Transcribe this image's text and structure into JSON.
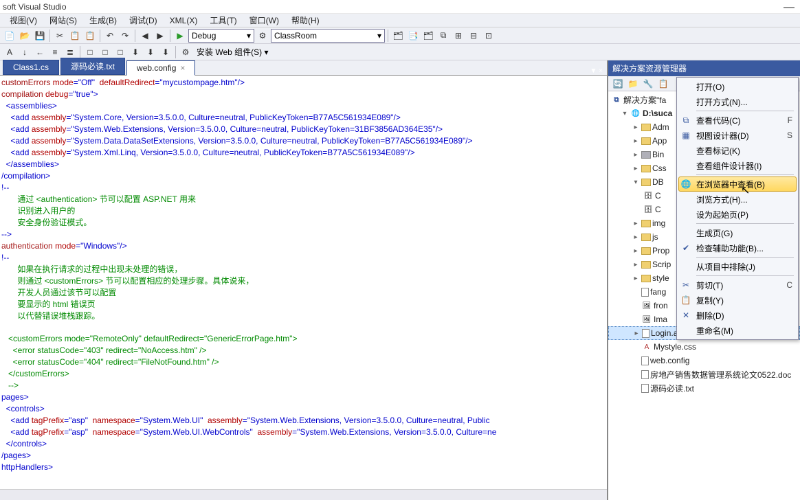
{
  "title": "soft Visual Studio",
  "menu": {
    "view": "视图(V)",
    "website": "网站(S)",
    "build": "生成(B)",
    "debug": "调试(D)",
    "xml": "XML(X)",
    "tools": "工具(T)",
    "window": "窗口(W)",
    "help": "帮助(H)"
  },
  "toolbar": {
    "config": "Debug",
    "project": "ClassRoom",
    "install": "安装 Web 组件(S)"
  },
  "tabs": {
    "class": "Class1.cs",
    "readme": "源码必读.txt",
    "webconfig": "web.config"
  },
  "sidepanel": {
    "title": "解决方案资源管理器"
  },
  "solution": {
    "label": "解决方案\"fa"
  },
  "project": {
    "label": "D:\\suca"
  },
  "tree": {
    "adm": "Adm",
    "app": "App",
    "bin": "Bin",
    "css": "Css",
    "db": "DB",
    "dbc1": "C",
    "dbc2": "C",
    "img": "img",
    "js": "js",
    "prop": "Prop",
    "scrip": "Scrip",
    "style": "style",
    "fang": "fang",
    "fron": "fron",
    "ima": "Ima",
    "login": "Login.aspx",
    "mystyle": "Mystyle.css",
    "webconfig": "web.config",
    "doc": "房地产销售数据管理系统论文0522.doc",
    "readme": "源码必读.txt"
  },
  "cm": {
    "open": "打开(O)",
    "openwith": "打开方式(N)...",
    "viewcode": "查看代码(C)",
    "viewdesigner": "视图设计器(D)",
    "viewmarkup": "查看标记(K)",
    "viewcomponent": "查看组件设计器(I)",
    "browse": "在浏览器中查看(B)",
    "browsewith": "浏览方式(H)...",
    "setstart": "设为起始页(P)",
    "build": "生成页(G)",
    "check": "检查辅助功能(B)...",
    "exclude": "从项目中排除(J)",
    "cut": "剪切(T)",
    "copy": "复制(Y)",
    "delete": "删除(D)",
    "rename": "重命名(M)",
    "sc_f": "F",
    "sc_s": "S",
    "sc_c": "C"
  },
  "code": {
    "l1a": "customErrors",
    "l1b": " mode",
    "l1c": "=\"Off\"",
    "l1d": "  defaultRedirect",
    "l1e": "=\"mycustompage.htm\"/>",
    "l2a": "compilation",
    "l2b": " debug",
    "l2c": "=\"true\">",
    "l3": "  <assemblies>",
    "add": "    <add",
    "asm": " assembly",
    "l4v": "=\"System.Core, Version=3.5.0.0, Culture=neutral, PublicKeyToken=B77A5C561934E089\"/>",
    "l5v": "=\"System.Web.Extensions, Version=3.5.0.0, Culture=neutral, PublicKeyToken=31BF3856AD364E35\"/>",
    "l6v": "=\"System.Data.DataSetExtensions, Version=3.5.0.0, Culture=neutral, PublicKeyToken=B77A5C561934E089\"/>",
    "l7v": "=\"System.Xml.Linq, Version=3.5.0.0, Culture=neutral, PublicKeyToken=B77A5C561934E089\"/>",
    "l8": "  </assemblies>",
    "l9": "/compilation>",
    "l10": "!--",
    "c1": "       通过 <authentication> 节可以配置 ASP.NET 用来 ",
    "c2": "       识别进入用户的",
    "c3": "       安全身份验证模式。 ",
    "l14": "-->",
    "l15a": "authentication",
    "l15b": " mode",
    "l15c": "=\"Windows\"/>",
    "l16": "!--",
    "c4": "       如果在执行请求的过程中出现未处理的错误，",
    "c5": "       则通过 <customErrors> 节可以配置相应的处理步骤。具体说来，",
    "c6": "       开发人员通过该节可以配置",
    "c7": "       要显示的 html 错误页",
    "c8": "       以代替错误堆栈跟踪。",
    "l23": "   <customErrors mode=\"RemoteOnly\" defaultRedirect=\"GenericErrorPage.htm\">",
    "l24": "     <error statusCode=\"403\" redirect=\"NoAccess.htm\" />",
    "l25": "     <error statusCode=\"404\" redirect=\"FileNotFound.htm\" />",
    "l26": "   </customErrors>",
    "l27": "   -->",
    "l28": "pages>",
    "l29": "  <controls>",
    "l30a": "    <add",
    "l30b": " tagPrefix",
    "l30c": "=\"asp\"",
    "l30d": "  namespace",
    "l30e": "=\"System.Web.UI\"",
    "l30f": "  assembly",
    "l30g": "=\"System.Web.Extensions, Version=3.5.0.0, Culture=neutral, Public",
    "l31a": "    <add",
    "l31b": " tagPrefix",
    "l31c": "=\"asp\"",
    "l31d": "  namespace",
    "l31e": "=\"System.Web.UI.WebControls\"",
    "l31f": "  assembly",
    "l31g": "=\"System.Web.Extensions, Version=3.5.0.0, Culture=ne",
    "l32": "  </controls>",
    "l33": "/pages>",
    "l34": "httpHandlers>"
  }
}
